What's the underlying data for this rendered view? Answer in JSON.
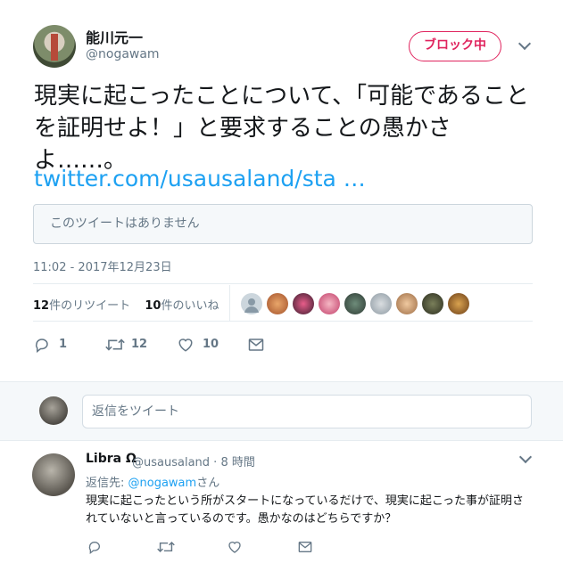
{
  "author": {
    "display_name": "能川元一",
    "handle": "@nogawam"
  },
  "block_button_label": "ブロック中",
  "tweet": {
    "text": "現実に起こったことについて、「可能であることを証明せよ！」と要求することの愚かさよ……。",
    "link_text": "twitter.com/usausaland/sta …",
    "quoted_unavailable": "このツイートはありません",
    "timestamp": "11:02 - 2017年12月23日",
    "retweets_count": "12",
    "retweets_label": "件のリツイート",
    "likes_count": "10",
    "likes_label": "件のいいね",
    "reply_count": "1",
    "retweet_action_count": "12",
    "like_action_count": "10"
  },
  "reply_box": {
    "placeholder": "返信をツイート"
  },
  "reply": {
    "display_name": "Libra Ω",
    "handle": "@usausaland",
    "separator": "·",
    "time": "8 時間",
    "reply_to_prefix": "返信先: ",
    "reply_to_handle": "@nogawam",
    "reply_to_suffix": "さん",
    "text": "現実に起こったという所がスタートになっているだけで、現実に起こった事が証明されていないと言っているのです。愚かなのはどちらですか？"
  },
  "colors": {
    "accent_blue": "#1da1f2",
    "block_red": "#e0245e",
    "muted": "#657786"
  },
  "icons": [
    "chevron-down-icon",
    "reply-icon",
    "retweet-icon",
    "heart-icon",
    "mail-icon"
  ]
}
